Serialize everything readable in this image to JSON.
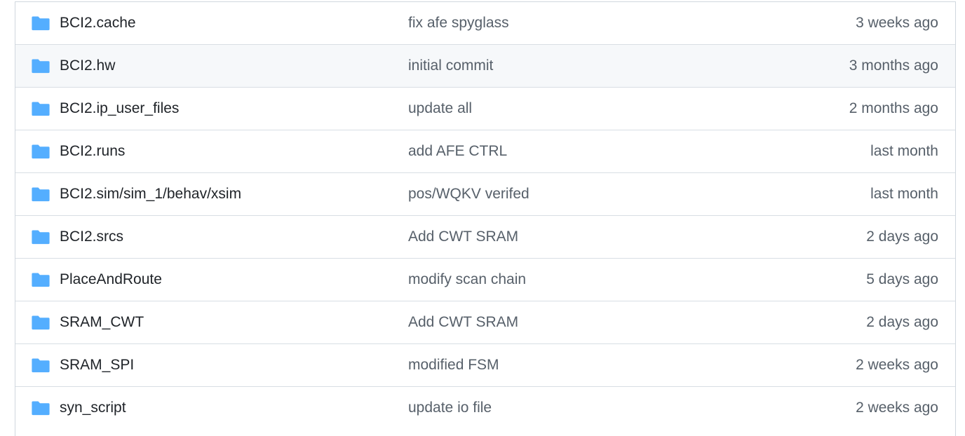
{
  "colors": {
    "folder_icon": "#54aeff",
    "name_text": "#1f2328",
    "muted_text": "#57606a",
    "border": "#d0d7de",
    "row_hover_bg": "#f6f8fa"
  },
  "rows": [
    {
      "name": "BCI2.cache",
      "message": "fix afe spyglass",
      "age": "3 weeks ago",
      "icon": "folder-icon"
    },
    {
      "name": "BCI2.hw",
      "message": "initial commit",
      "age": "3 months ago",
      "icon": "folder-icon"
    },
    {
      "name": "BCI2.ip_user_files",
      "message": "update all",
      "age": "2 months ago",
      "icon": "folder-icon"
    },
    {
      "name": "BCI2.runs",
      "message": "add AFE CTRL",
      "age": "last month",
      "icon": "folder-icon"
    },
    {
      "name": "BCI2.sim/sim_1/behav/xsim",
      "message": "pos/WQKV verifed",
      "age": "last month",
      "icon": "folder-icon"
    },
    {
      "name": "BCI2.srcs",
      "message": "Add CWT SRAM",
      "age": "2 days ago",
      "icon": "folder-icon"
    },
    {
      "name": "PlaceAndRoute",
      "message": "modify scan chain",
      "age": "5 days ago",
      "icon": "folder-icon"
    },
    {
      "name": "SRAM_CWT",
      "message": "Add CWT SRAM",
      "age": "2 days ago",
      "icon": "folder-icon"
    },
    {
      "name": "SRAM_SPI",
      "message": "modified FSM",
      "age": "2 weeks ago",
      "icon": "folder-icon"
    },
    {
      "name": "syn_script",
      "message": "update io file",
      "age": "2 weeks ago",
      "icon": "folder-icon"
    }
  ]
}
